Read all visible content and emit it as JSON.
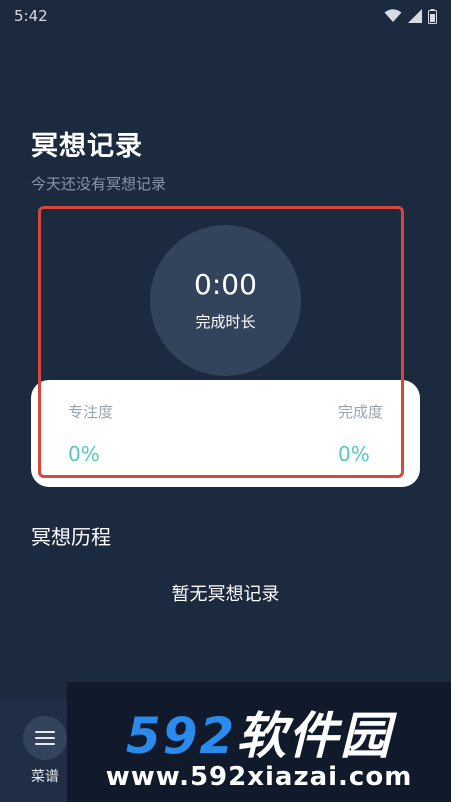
{
  "status_bar": {
    "time": "5:42"
  },
  "header": {
    "title": "冥想记录",
    "subtitle": "今天还没有冥想记录"
  },
  "summary": {
    "duration": "0:00",
    "duration_label": "完成时长",
    "focus_label": "专注度",
    "focus_value": "0%",
    "completion_label": "完成度",
    "completion_value": "0%"
  },
  "history": {
    "title": "冥想历程",
    "empty_text": "暂无冥想记录"
  },
  "bottom_nav": {
    "menu_label": "菜谱"
  },
  "watermark": {
    "brand_number": "592",
    "brand_text": "软件园",
    "url": "www.592xiazai.com"
  },
  "colors": {
    "background": "#1c2a40",
    "accent": "#54c7c7",
    "highlight": "#d8463c"
  }
}
